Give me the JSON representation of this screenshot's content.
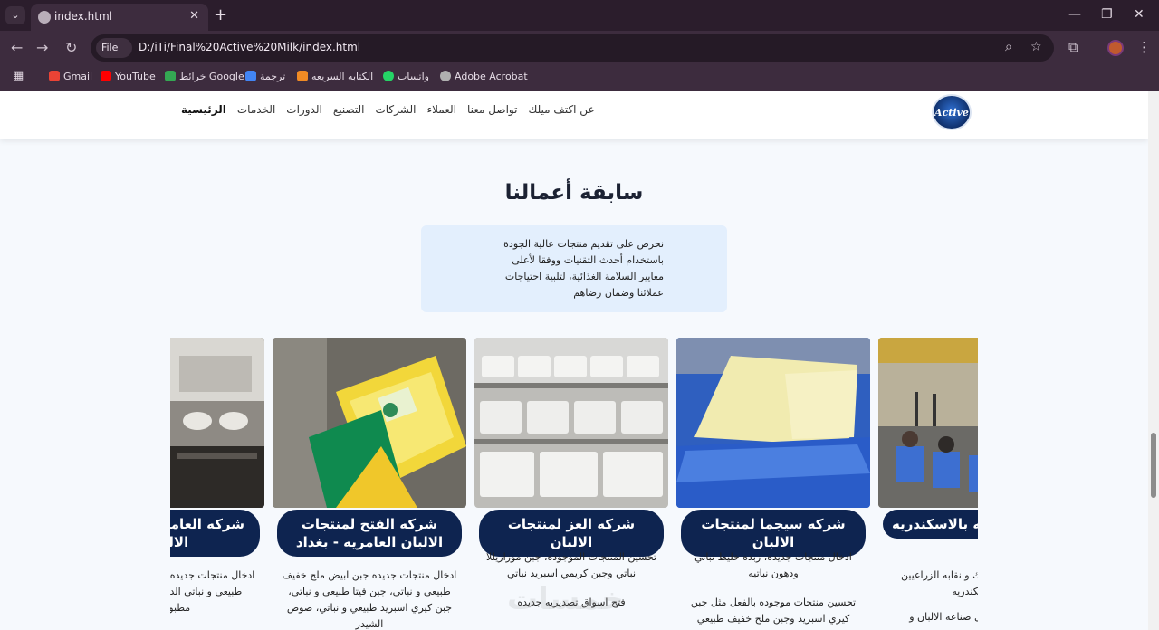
{
  "browser": {
    "tab_title": "index.html",
    "url_chip": "File",
    "url": "D:/iTi/Final%20Active%20Milk/index.html",
    "bookmarks": [
      {
        "label": "Gmail",
        "color": "#ea4335"
      },
      {
        "label": "YouTube",
        "color": "#ff0000"
      },
      {
        "label": "خرائط Google",
        "color": "#34a853"
      },
      {
        "label": "ترجمة",
        "color": "#4285f4"
      },
      {
        "label": "الكتابه السريعه",
        "color": "#f08a24"
      },
      {
        "label": "واتساب",
        "color": "#25d366"
      },
      {
        "label": "Adobe Acrobat",
        "color": "#b0b0b0"
      }
    ]
  },
  "site": {
    "logo_text": "Active",
    "nav": [
      "الرئيسية",
      "الخدمات",
      "الدورات",
      "التصنيع",
      "الشركات",
      "العملاء",
      "تواصل معنا",
      "عن اكتف ميلك"
    ]
  },
  "section": {
    "title": "سابقة أعمالنا",
    "intro": "نحرص على تقديم منتجات عالية الجودة باستخدام أحدث التقنيات ووفقا لأعلى معايير السلامة الغذائية، لتلبية احتياجات عملائنا وضمان رضاهم"
  },
  "cards": [
    {
      "title": "شركه العامريه لمنتجات الالبان",
      "desc": "ادخال منتجات جديده جبن ابيض ملح خفيف طبيعي و نباتي الدهن وجبن مطبوخ و مطبوخ بلي",
      "photo": "machine"
    },
    {
      "title": "شركه الفتح لمنتجات الالبان العامريه - بغداد",
      "desc": "ادخال منتجات جديده جبن ابيض ملح خفيف طبيعي و نباتي، جبن فيتا طبيعي و نباتي، جبن كيري اسبريد طبيعي و نباتي، صوص الشيدر",
      "photo": "cheese"
    },
    {
      "title": "شركه العز لمنتجات الالبان",
      "desc": "تحسين المنتجات الموجوده، جبن موزاريللا نباتي وجبن كريمي اسبريد نباتي",
      "desc2": "فتح اسواق تصديريه جديده",
      "photo": "trays"
    },
    {
      "title": "شركه سيجما لمنتجات الالبان",
      "desc": "ادخال منتجات جديده، زبده خليط نباتي ودهون نباتيه",
      "desc2": "تحسين منتجات موجوده بالفعل مثل جبن كيري اسبريد وجبن ملح خفيف طبيعي",
      "photo": "butter"
    },
    {
      "title": "كليه الزراعيه بالاسكندريه",
      "desc": "شراكه اكتيف ميلك و نقابه الزراعيين بالاسكندريه",
      "desc2": "تدريب في مجال صناعه الالبان و",
      "photo": "hall"
    }
  ],
  "watermark": "خمسات"
}
